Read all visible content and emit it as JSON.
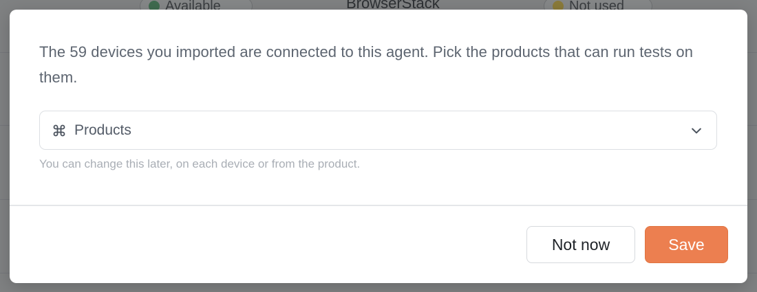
{
  "background": {
    "title": "BrowserStack",
    "pill_left": "Available",
    "pill_right": "Not used"
  },
  "modal": {
    "description": "The 59 devices you imported are connected to this agent. Pick the products that can run tests on them.",
    "products_select": {
      "icon": "command-icon",
      "label": "Products",
      "dropdown_icon": "chevron-down-icon"
    },
    "hint": "You can change this later, on each device or from the product.",
    "actions": {
      "secondary_label": "Not now",
      "primary_label": "Save"
    }
  },
  "colors": {
    "primary_button": "#ec7f50",
    "overlay": "#7f8182",
    "text_muted": "#5d6570",
    "hint_text": "#a9aeb5"
  }
}
